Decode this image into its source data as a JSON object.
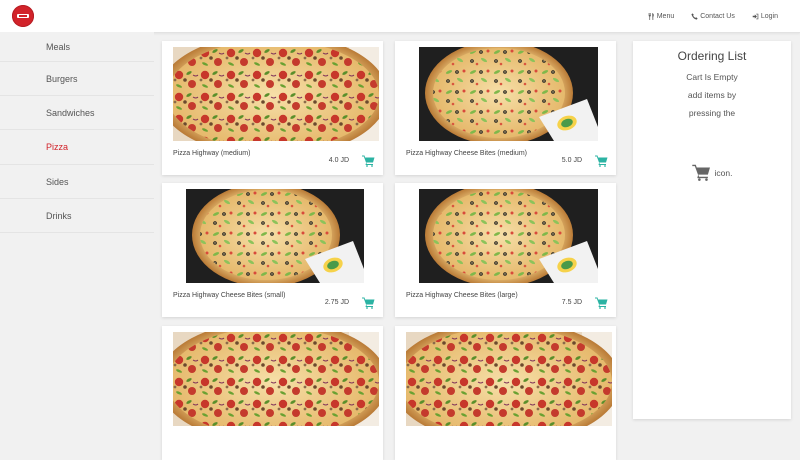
{
  "nav": {
    "menu": "Menu",
    "contact": "Contact Us",
    "login": "Login"
  },
  "sidebar": {
    "items": [
      {
        "label": "Meals"
      },
      {
        "label": "Burgers"
      },
      {
        "label": "Sandwiches"
      },
      {
        "label": "Pizza",
        "active": true
      },
      {
        "label": "Sides"
      },
      {
        "label": "Drinks"
      }
    ]
  },
  "products": [
    {
      "name": "Pizza Highway (medium)",
      "price": "4.0 JD"
    },
    {
      "name": "Pizza Highway Cheese Bites (medium)",
      "price": "5.0 JD"
    },
    {
      "name": "Pizza Highway Cheese Bites (small)",
      "price": "2.75 JD"
    },
    {
      "name": "Pizza Highway Cheese Bites (large)",
      "price": "7.5 JD"
    }
  ],
  "order": {
    "title": "Ordering List",
    "empty": "Cart Is Empty",
    "hint1": "add items by",
    "hint2": "pressing the",
    "hint3": "icon."
  },
  "colors": {
    "brand": "#d2232a",
    "accent": "#2bb3a3"
  }
}
